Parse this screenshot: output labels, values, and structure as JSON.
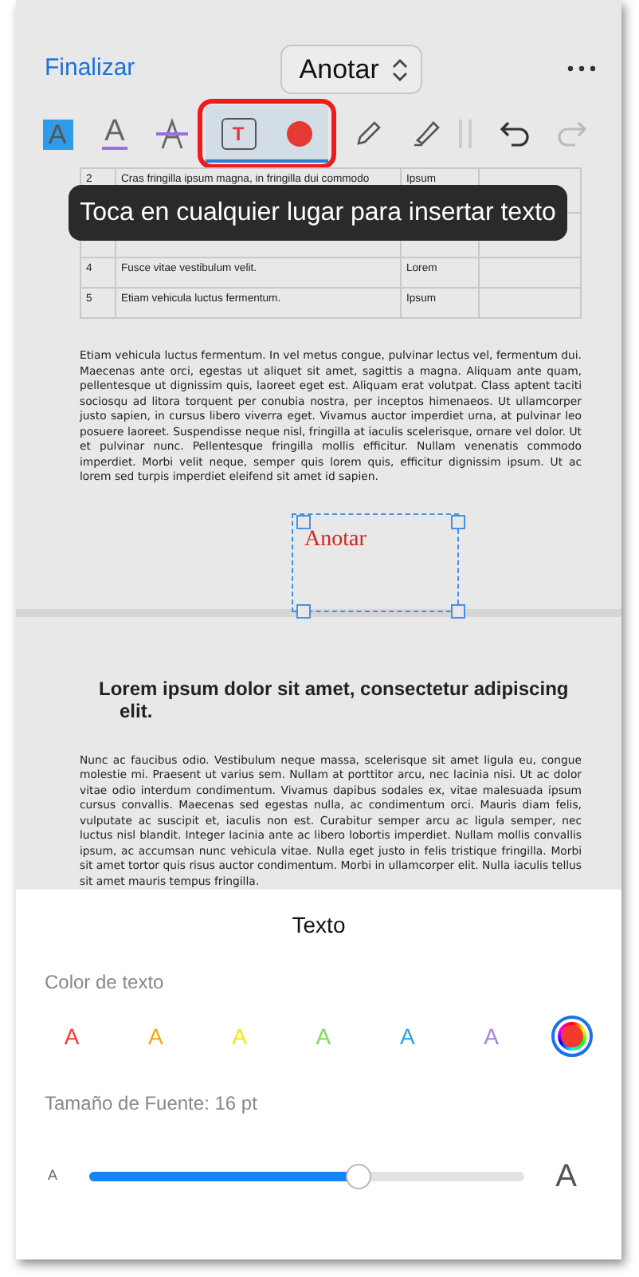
{
  "header": {
    "done": "Finalizar",
    "mode": "Anotar"
  },
  "toolbar": [
    {
      "kind": "highlight",
      "label": "A",
      "selected": false
    },
    {
      "kind": "underline",
      "label": "A",
      "selected": false
    },
    {
      "kind": "strikethrough",
      "selected": false
    },
    {
      "kind": "textbox",
      "label": "T",
      "selected": true
    },
    {
      "kind": "color",
      "selected": true
    },
    {
      "kind": "pencil",
      "selected": false
    },
    {
      "kind": "highlighter",
      "selected": false
    },
    {
      "kind": "divider"
    },
    {
      "kind": "undo",
      "disabled": false
    },
    {
      "kind": "redo",
      "disabled": true
    }
  ],
  "tooltip": "Toca en cualquier lugar para insertar texto",
  "document": {
    "table": {
      "rows": [
        [
          "2",
          "Cras fringilla ipsum magna, in fringilla dui commodo",
          "Ipsum",
          ""
        ],
        [
          "",
          "",
          "",
          ""
        ],
        [
          "4",
          "Fusce vitae vestibulum velit.",
          "Lorem",
          ""
        ],
        [
          "5",
          "Etiam vehicula luctus fermentum.",
          "Ipsum",
          ""
        ]
      ]
    },
    "paragraph_1": "Etiam vehicula luctus fermentum. In vel metus congue, pulvinar lectus vel, fermentum dui. Maecenas ante orci, egestas ut aliquet sit amet, sagittis a magna. Aliquam ante quam, pellentesque ut dignissim quis, laoreet eget est. Aliquam erat volutpat. Class aptent taciti sociosqu ad litora torquent per conubia nostra, per inceptos himenaeos. Ut ullamcorper justo sapien, in cursus libero viverra eget. Vivamus auctor imperdiet urna, at pulvinar leo posuere laoreet. Suspendisse neque nisl, fringilla at iaculis scelerisque, ornare vel dolor. Ut et pulvinar nunc. Pellentesque fringilla mollis efficitur. Nullam venenatis commodo imperdiet. Morbi velit neque, semper quis lorem quis, efficitur dignissim ipsum. Ut ac lorem sed turpis imperdiet eleifend sit amet id sapien.",
    "annotation": "Anotar",
    "heading": "Lorem ipsum dolor sit amet, consectetur adipiscing elit.",
    "paragraph_2": "Nunc ac faucibus odio. Vestibulum neque massa, scelerisque sit amet ligula eu, congue molestie mi. Praesent ut varius sem. Nullam at porttitor arcu, nec lacinia nisi. Ut ac dolor vitae odio interdum condimentum. Vivamus dapibus sodales ex, vitae malesuada ipsum cursus convallis. Maecenas sed egestas nulla, ac condimentum orci. Mauris diam felis, vulputate ac suscipit et, iaculis non est. Curabitur semper arcu ac ligula semper, nec luctus nisl blandit. Integer lacinia ante ac libero lobortis imperdiet. Nullam mollis convallis ipsum, ac accumsan nunc vehicula vitae. Nulla eget justo in felis tristique fringilla. Morbi sit amet tortor quis risus auctor condimentum. Morbi in ullamcorper elit. Nulla iaculis tellus sit amet mauris tempus fringilla."
  },
  "sheet": {
    "title": "Texto",
    "color_label": "Color de texto",
    "colors": [
      {
        "kind": "swatch",
        "label": "A",
        "color": "#f23a2f",
        "selected": false
      },
      {
        "kind": "swatch",
        "label": "A",
        "color": "#f7a21b",
        "selected": false
      },
      {
        "kind": "swatch",
        "label": "A",
        "color": "#f5e617",
        "selected": false
      },
      {
        "kind": "swatch",
        "label": "A",
        "color": "#7ddc5a",
        "selected": false
      },
      {
        "kind": "swatch",
        "label": "A",
        "color": "#22a3ee",
        "selected": false
      },
      {
        "kind": "swatch",
        "label": "A",
        "color": "#a383e0",
        "selected": false
      },
      {
        "kind": "custom",
        "color": "#f23a2f",
        "selected": true
      }
    ],
    "size_label": "Tamaño de Fuente: 16 pt",
    "slider": {
      "min_label": "A",
      "max_label": "A",
      "level": 0.62
    }
  }
}
